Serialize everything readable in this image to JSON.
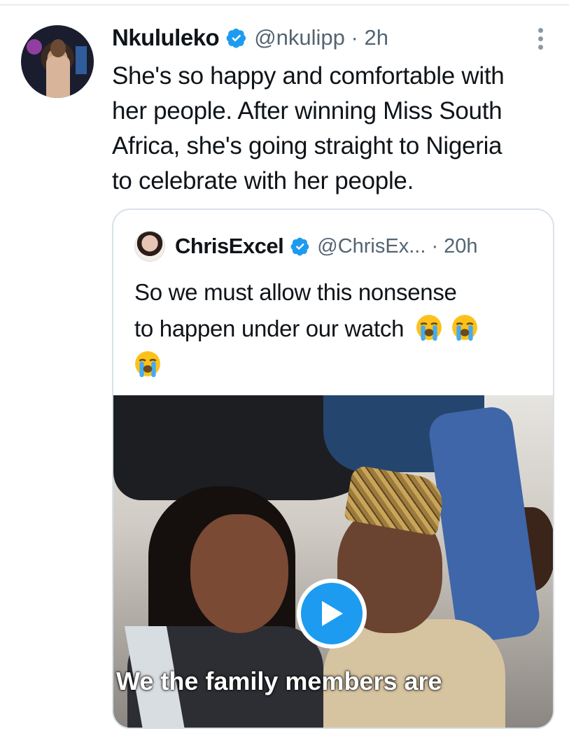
{
  "tweet": {
    "author_name": "Nkululeko",
    "handle_time": "@nkulipp · 2h",
    "text_lines": [
      "She's so happy and comfortable with",
      "her people. After winning Miss South",
      "Africa, she's going straight to Nigeria",
      "to celebrate with her people."
    ],
    "icons": {
      "verified": "verified-badge-icon",
      "more": "more-options-icon"
    }
  },
  "quote": {
    "author_name": "ChrisExcel",
    "handle_time": "@ChrisEx... · 20h",
    "text_lines": [
      "So we must allow this nonsense",
      "to happen under our watch"
    ],
    "emojis": [
      "loudly-crying-face",
      "loudly-crying-face",
      "loudly-crying-face"
    ],
    "media": {
      "caption": "We the family members are",
      "play_icon": "play-icon"
    }
  },
  "colors": {
    "verified": "#1d9bf0",
    "secondary_text": "#536471",
    "play_button": "#1d9bf0",
    "card_border": "#d9e1e8"
  }
}
